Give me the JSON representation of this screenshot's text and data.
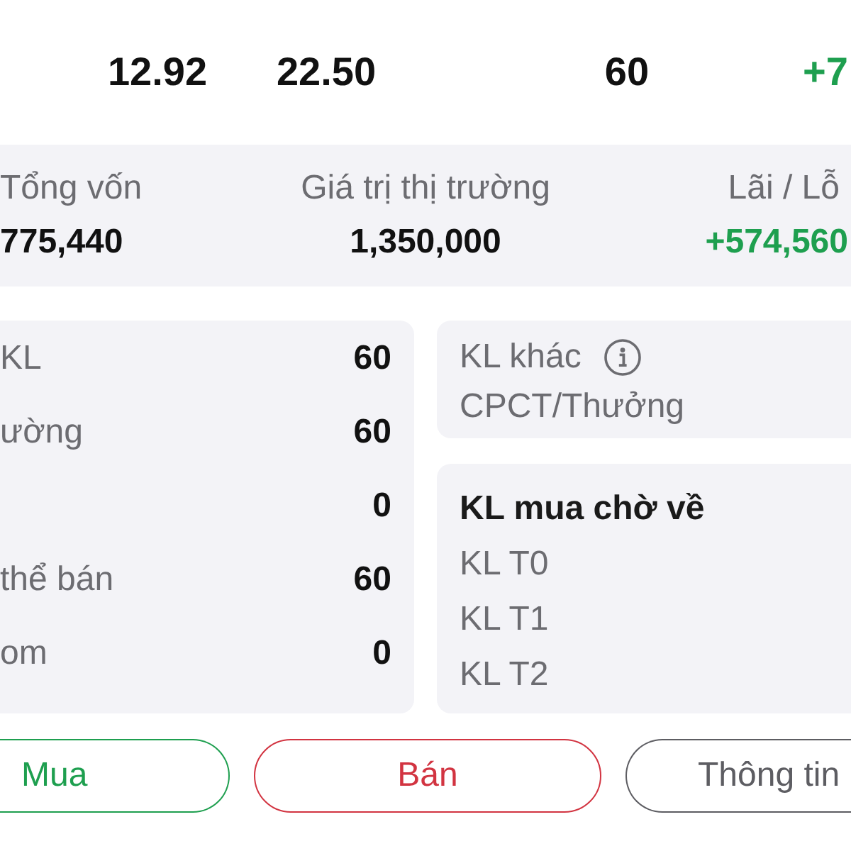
{
  "top_row": [
    {
      "text": "12.92",
      "kind": "value"
    },
    {
      "text": "22.50",
      "kind": "value"
    },
    {
      "text": "60",
      "kind": "value"
    },
    {
      "text": "+7",
      "kind": "gain"
    }
  ],
  "summary": [
    {
      "label": "Tổng vốn",
      "value": "775,440",
      "kind": "value"
    },
    {
      "label": "Giá trị thị trường",
      "value": "1,350,000",
      "kind": "value"
    },
    {
      "label": "Lãi / Lỗ",
      "value": "+574,560",
      "kind": "gain"
    }
  ],
  "holdings": [
    {
      "label": "KL",
      "value": "60"
    },
    {
      "label": "ường",
      "value": "60"
    },
    {
      "value": "0"
    },
    {
      "label": "thể bán",
      "value": "60"
    },
    {
      "label": "om",
      "value": "0"
    }
  ],
  "other_volume": {
    "title": "KL khác",
    "subtitle": "CPCT/Thưởng"
  },
  "pending": {
    "title": "KL mua chờ về",
    "rows": [
      "KL T0",
      "KL T1",
      "KL T2"
    ]
  },
  "buttons": [
    {
      "label": "Mua",
      "kind": "buy"
    },
    {
      "label": "Bán",
      "kind": "sell"
    },
    {
      "label": "Thông tin",
      "kind": "info"
    }
  ]
}
